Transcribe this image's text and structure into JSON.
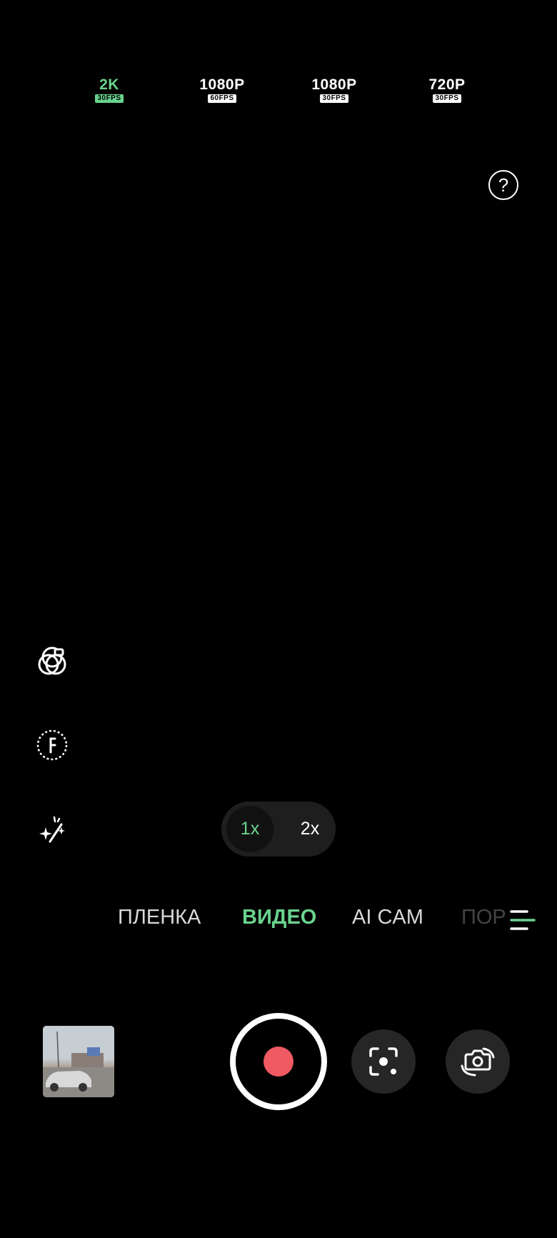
{
  "resolutions": [
    {
      "main": "2K",
      "sub": "30FPS",
      "active": true
    },
    {
      "main": "1080P",
      "sub": "60FPS",
      "active": false
    },
    {
      "main": "1080P",
      "sub": "30FPS",
      "active": false
    },
    {
      "main": "720P",
      "sub": "30FPS",
      "active": false
    }
  ],
  "help": {
    "glyph": "?"
  },
  "side_icons": [
    "filter-icon",
    "focus-f-icon",
    "beauty-magic-icon"
  ],
  "zoom": {
    "active": "1x",
    "other": "2x"
  },
  "modes": [
    "ПЛЕНКА",
    "ВИДЕО",
    "AI CAM",
    "ПОР"
  ],
  "active_mode": "ВИДЕО",
  "icons": {
    "menu": "more-modes-icon",
    "gallery": "gallery-thumbnail",
    "record": "record-button",
    "lens": "google-lens-icon",
    "switch": "switch-camera-icon"
  },
  "colors": {
    "accent": "#6ad38e",
    "record": "#ef5a63",
    "background": "#000000"
  }
}
